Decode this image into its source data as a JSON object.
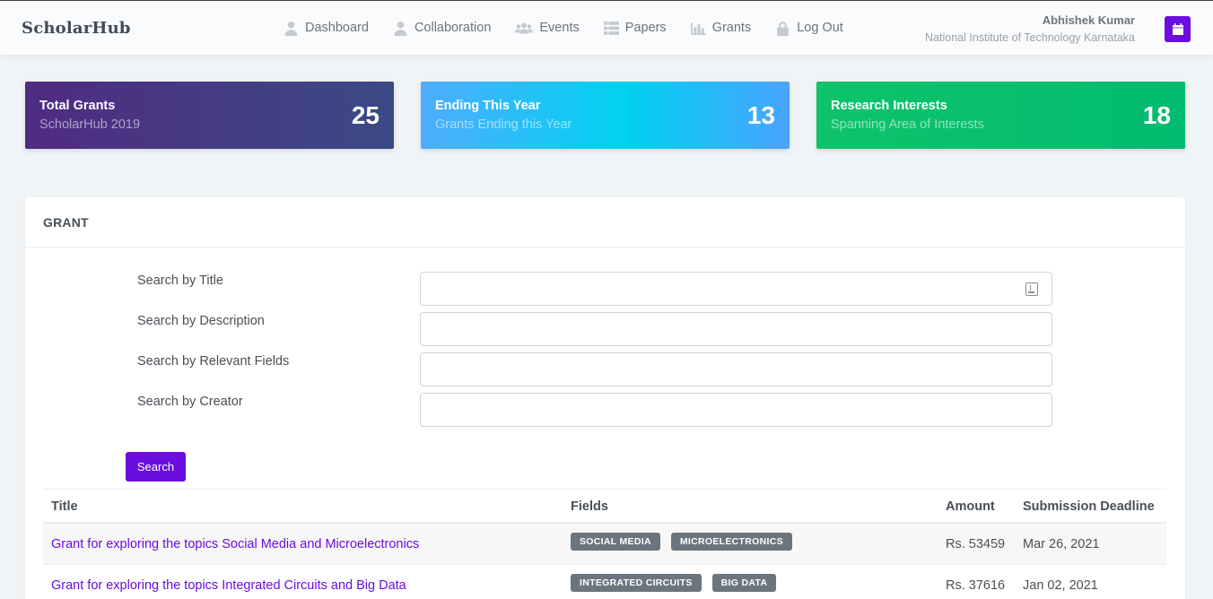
{
  "app": {
    "logo": "ScholarHub"
  },
  "nav": {
    "items": [
      {
        "label": "Dashboard",
        "icon": "user-icon"
      },
      {
        "label": "Collaboration",
        "icon": "user-icon"
      },
      {
        "label": "Events",
        "icon": "users-icon"
      },
      {
        "label": "Papers",
        "icon": "list-icon"
      },
      {
        "label": "Grants",
        "icon": "bar-chart-icon"
      },
      {
        "label": "Log Out",
        "icon": "lock-icon"
      }
    ]
  },
  "user": {
    "name": "Abhishek Kumar",
    "organization": "National Institute of Technology Karnataka",
    "calendar_icon": "calendar-icon"
  },
  "stats": [
    {
      "title": "Total Grants",
      "subtitle": "ScholarHub 2019",
      "value": "25"
    },
    {
      "title": "Ending This Year",
      "subtitle": "Grants Ending this Year",
      "value": "13"
    },
    {
      "title": "Research Interests",
      "subtitle": "Spanning Area of Interests",
      "value": "18"
    }
  ],
  "panel": {
    "heading": "GRANT",
    "form": {
      "title_label": "Search by Title",
      "title_value": "",
      "description_label": "Search by Description",
      "description_value": "",
      "fields_label": "Search by Relevant Fields",
      "fields_value": "",
      "creator_label": "Search by Creator",
      "creator_value": "",
      "search_button": "Search"
    },
    "table": {
      "headers": {
        "title": "Title",
        "fields": "Fields",
        "amount": "Amount",
        "deadline": "Submission Deadline"
      },
      "rows": [
        {
          "title": "Grant for exploring the topics Social Media and Microelectronics",
          "fields": [
            "SOCIAL MEDIA",
            "MICROELECTRONICS"
          ],
          "amount": "Rs. 53459",
          "deadline": "Mar 26, 2021"
        },
        {
          "title": "Grant for exploring the topics Integrated Circuits and Big Data",
          "fields": [
            "INTEGRATED CIRCUITS",
            "BIG DATA"
          ],
          "amount": "Rs. 37616",
          "deadline": "Jan 02, 2021"
        }
      ]
    }
  },
  "colors": {
    "accent": "#6a0dde",
    "badge": "#6c757d",
    "card1": "#4f2b82",
    "card2": "#00d2f0",
    "card3": "#0ec36b"
  }
}
